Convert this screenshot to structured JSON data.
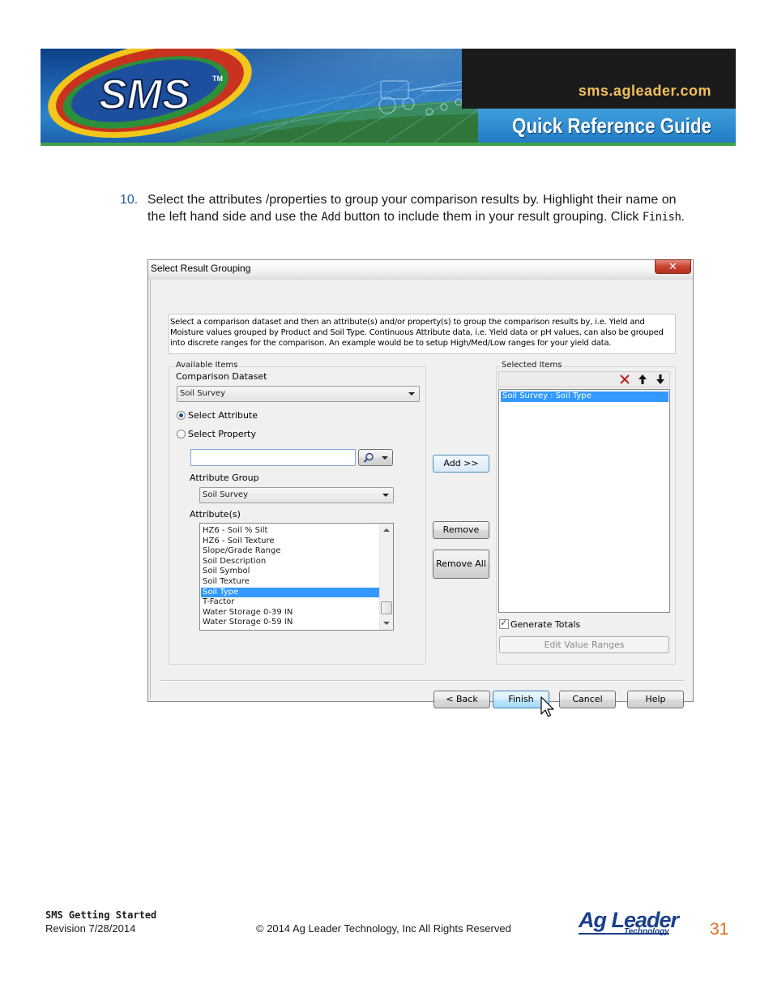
{
  "header": {
    "logo_text": "SMS",
    "url": "sms.agleader.com",
    "guide_title": "Quick Reference Guide"
  },
  "step": {
    "number": "10.",
    "text_1": "Select the attributes /properties to group your comparison results by. Highlight their name on the left hand side and use the ",
    "kw_add": "Add",
    "text_2": " button to include them in your result grouping. Click ",
    "kw_finish": "Finish",
    "text_3": "."
  },
  "dialog": {
    "title": "Select Result Grouping",
    "close_glyph": "✕",
    "description": "Select a comparison dataset and then an attribute(s) and/or property(s) to group the comparison results by, i.e. Yield and Moisture values grouped by Product and Soil Type.  Continuous Attribute data, i.e. Yield data or pH values, can also be grouped into discrete ranges for the comparison.  An example would be to setup High/Med/Low ranges for your yield data.",
    "available": {
      "group_label": "Available Items",
      "dataset_label": "Comparison Dataset",
      "dataset_value": "Soil Survey",
      "radio_attribute": "Select Attribute",
      "radio_property": "Select Property",
      "search_value": "",
      "attribute_group_label": "Attribute Group",
      "attribute_group_value": "Soil Survey",
      "attributes_label": "Attribute(s)",
      "attributes": [
        "HZ6 - Soil % Silt",
        "HZ6 - Soil Texture",
        "Slope/Grade Range",
        "Soil Description",
        "Soil Symbol",
        "Soil Texture",
        "Soil Type",
        "T-Factor",
        "Water Storage 0-39 IN",
        "Water Storage 0-59 IN"
      ],
      "selected_attribute_index": 6
    },
    "buttons": {
      "add": "Add >>",
      "remove": "Remove",
      "remove_all": "Remove All",
      "back": "< Back",
      "finish": "Finish",
      "cancel": "Cancel",
      "help": "Help",
      "edit_value_ranges": "Edit Value Ranges"
    },
    "selected": {
      "group_label": "Selected Items",
      "items": [
        "Soil Survey : Soil Type"
      ],
      "generate_totals_label": "Generate Totals",
      "generate_totals_checked": true
    }
  },
  "footer": {
    "doc_title": "SMS Getting Started",
    "revision": "Revision 7/28/2014",
    "copyright": "© 2014 Ag Leader Technology, Inc All Rights Reserved",
    "brand": "Ag Leader",
    "brand_sub": "Technology",
    "page_number": "31"
  },
  "colors": {
    "step_number": "#1f5fa8",
    "page_number": "#e06a1b",
    "brand": "#1b3f8b",
    "selection": "#3399ff"
  }
}
